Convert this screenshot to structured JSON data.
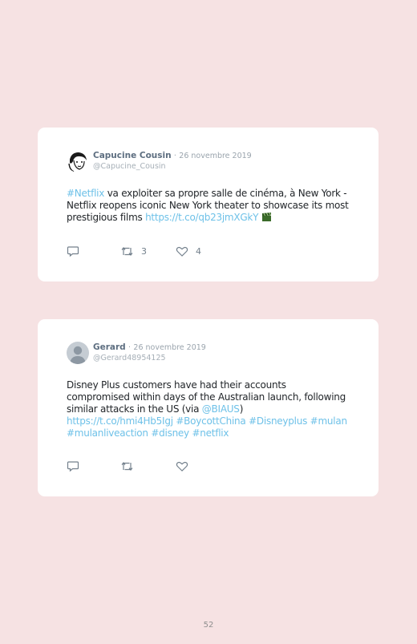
{
  "tweets": [
    {
      "author": "Capucine Cousin",
      "date": "26 novembre 2019",
      "handle": "@Capucine_Cousin",
      "text": {
        "hashtag_lead": "#Netflix",
        "body": " va exploiter sa propre salle de cinéma, à New York - Netflix reopens iconic New York theater to showcase its most prestigious films ",
        "link": "https://t.co/qb23jmXGkY"
      },
      "emoji_icon": "clapper-board-icon",
      "retweets": "3",
      "likes": "4"
    },
    {
      "author": "Gerard",
      "date": "26 novembre 2019",
      "handle": "@Gerard48954125",
      "text": {
        "body": "Disney Plus customers have had their accounts compromised within days of the Australian launch, following similar attacks in the US (via ",
        "mention": "@BIAUS",
        "close": ")",
        "link": "https://t.co/hmi4Hb5Igj",
        "hashtags": [
          "#BoycottChina",
          "#Disneyplus",
          "#mulan",
          "#mulanliveaction",
          "#disney",
          "#netflix"
        ]
      },
      "retweets": "",
      "likes": ""
    }
  ],
  "date_separator": "·",
  "page_number": "52",
  "colors": {
    "background": "#f6e2e3",
    "card": "#ffffff",
    "link": "#6ec1e8",
    "meta": "#9aa4ad"
  }
}
